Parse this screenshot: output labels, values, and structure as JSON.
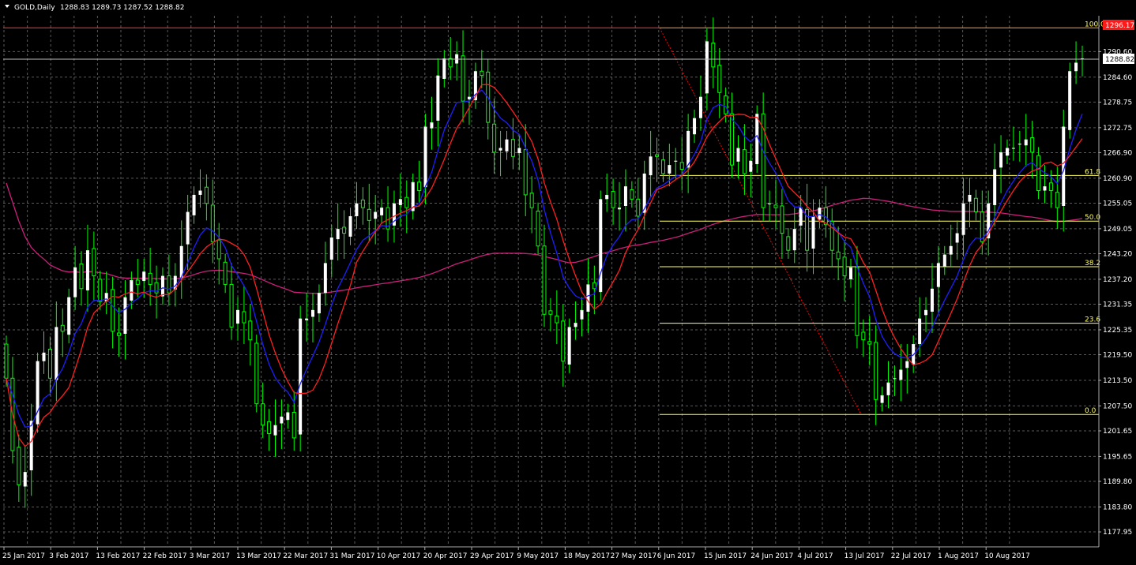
{
  "header": {
    "symbol_timeframe": "GOLD,Daily",
    "ohlc": "1288.83 1289.73 1287.52 1288.82"
  },
  "colors": {
    "background": "#000000",
    "grid": "#5a5a5a",
    "bull_body": "#ffffff",
    "candle_wick": "#00ff00",
    "ma_fast": "#1f1fff",
    "ma_slow": "#ff2020",
    "ma_long": "#cc1f7a",
    "fibo": "#ffff66",
    "fibo_high_line": "#ff3b3b",
    "fibo_trend": "#ff0000",
    "axis_text": "#ffffff"
  },
  "chart_data": {
    "type": "candlestick",
    "symbol": "GOLD",
    "timeframe": "Daily",
    "ylim": [
      1175.0,
      1299.0
    ],
    "grid": true,
    "y_ticks": [
      "1290.60",
      "1284.60",
      "1278.75",
      "1272.75",
      "1266.90",
      "1260.90",
      "1255.05",
      "1249.05",
      "1243.20",
      "1237.20",
      "1231.35",
      "1225.35",
      "1219.50",
      "1213.50",
      "1207.50",
      "1201.65",
      "1195.65",
      "1189.80",
      "1183.80",
      "1177.95"
    ],
    "x_ticks": [
      "25 Jan 2017",
      "3 Feb 2017",
      "13 Feb 2017",
      "22 Feb 2017",
      "3 Mar 2017",
      "13 Mar 2017",
      "22 Mar 2017",
      "31 Mar 2017",
      "10 Apr 2017",
      "20 Apr 2017",
      "29 Apr 2017",
      "9 May 2017",
      "18 May 2017",
      "27 May 2017",
      "6 Jun 2017",
      "15 Jun 2017",
      "24 Jun 2017",
      "4 Jul 2017",
      "13 Jul 2017",
      "22 Jul 2017",
      "1 Aug 2017",
      "10 Aug 2017"
    ],
    "current_price": "1288.82",
    "red_level_label": "1296.17",
    "close": [
      1214.0,
      1197.0,
      1189.0,
      1192.0,
      1204.0,
      1218.0,
      1220.0,
      1214.0,
      1226.0,
      1225.0,
      1233.0,
      1240.0,
      1235.0,
      1244.0,
      1238.0,
      1232.0,
      1234.0,
      1225.0,
      1224.0,
      1233.0,
      1237.0,
      1236.0,
      1239.0,
      1236.0,
      1234.0,
      1238.0,
      1234.0,
      1238.0,
      1245.0,
      1253.0,
      1257.0,
      1258.0,
      1255.0,
      1246.0,
      1242.0,
      1236.0,
      1226.0,
      1230.0,
      1227.0,
      1223.0,
      1208.0,
      1203.0,
      1201.0,
      1203.0,
      1205.0,
      1206.0,
      1200.0,
      1228.0,
      1228.0,
      1230.0,
      1234.0,
      1241.0,
      1247.0,
      1249.0,
      1248.0,
      1252.0,
      1255.0,
      1254.0,
      1251.0,
      1253.0,
      1254.0,
      1249.0,
      1255.0,
      1256.0,
      1254.0,
      1260.0,
      1258.0,
      1273.0,
      1274.0,
      1285.0,
      1289.0,
      1287.0,
      1290.0,
      1279.0,
      1280.0,
      1286.0,
      1285.0,
      1274.0,
      1267.0,
      1268.0,
      1270.0,
      1266.0,
      1268.0,
      1257.0,
      1254.0,
      1245.0,
      1229.0,
      1229.0,
      1227.0,
      1218.0,
      1226.0,
      1227.0,
      1230.0,
      1236.0,
      1235.0,
      1256.0,
      1257.0,
      1254.0,
      1254.0,
      1259.0,
      1256.0,
      1252.0,
      1262.0,
      1266.0,
      1266.0,
      1262.0,
      1264.0,
      1265.0,
      1263.0,
      1272.0,
      1275.0,
      1280.0,
      1293.0,
      1287.0,
      1281.0,
      1276.0,
      1264.0,
      1268.0,
      1262.0,
      1265.0,
      1276.0,
      1254.0,
      1255.0,
      1254.0,
      1248.0,
      1244.0,
      1249.0,
      1254.0,
      1244.0,
      1252.0,
      1254.0,
      1250.0,
      1244.0,
      1242.0,
      1238.0,
      1240.0,
      1224.0,
      1223.0,
      1222.0,
      1209.0,
      1210.0,
      1213.0,
      1214.0,
      1216.0,
      1218.0,
      1222.0,
      1228.0,
      1230.0,
      1235.0,
      1241.0,
      1243.0,
      1245.0,
      1248.0,
      1255.0,
      1257.0,
      1253.0,
      1246.0,
      1255.0,
      1263.0,
      1267.0,
      1268.0,
      1268.0,
      1269.0,
      1270.0,
      1267.0,
      1258.0,
      1259.0,
      1258.0,
      1254.0,
      1273.0,
      1286.0,
      1288.0,
      1289.0
    ]
  }
}
